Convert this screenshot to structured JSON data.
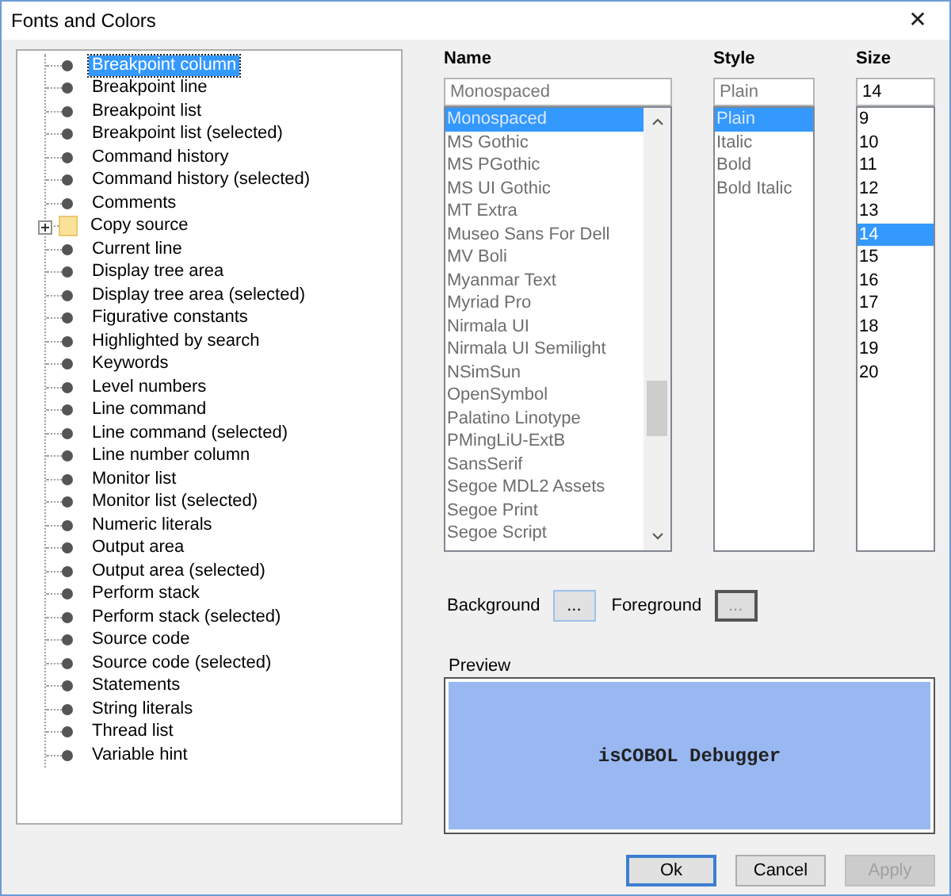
{
  "window": {
    "title": "Fonts and Colors",
    "close": "✕"
  },
  "tree": {
    "items": [
      {
        "label": "Breakpoint column",
        "kind": "leaf",
        "selected": true
      },
      {
        "label": "Breakpoint line",
        "kind": "leaf",
        "selected": false
      },
      {
        "label": "Breakpoint list",
        "kind": "leaf",
        "selected": false
      },
      {
        "label": "Breakpoint list (selected)",
        "kind": "leaf",
        "selected": false
      },
      {
        "label": "Command history",
        "kind": "leaf",
        "selected": false
      },
      {
        "label": "Command history (selected)",
        "kind": "leaf",
        "selected": false
      },
      {
        "label": "Comments",
        "kind": "leaf",
        "selected": false
      },
      {
        "label": "Copy source",
        "kind": "folder",
        "expanded": false,
        "selected": false
      },
      {
        "label": "Current line",
        "kind": "leaf",
        "selected": false
      },
      {
        "label": "Display tree area",
        "kind": "leaf",
        "selected": false
      },
      {
        "label": "Display tree area (selected)",
        "kind": "leaf",
        "selected": false
      },
      {
        "label": "Figurative constants",
        "kind": "leaf",
        "selected": false
      },
      {
        "label": "Highlighted by search",
        "kind": "leaf",
        "selected": false
      },
      {
        "label": "Keywords",
        "kind": "leaf",
        "selected": false
      },
      {
        "label": "Level numbers",
        "kind": "leaf",
        "selected": false
      },
      {
        "label": "Line command",
        "kind": "leaf",
        "selected": false
      },
      {
        "label": "Line command (selected)",
        "kind": "leaf",
        "selected": false
      },
      {
        "label": "Line number column",
        "kind": "leaf",
        "selected": false
      },
      {
        "label": "Monitor list",
        "kind": "leaf",
        "selected": false
      },
      {
        "label": "Monitor list (selected)",
        "kind": "leaf",
        "selected": false
      },
      {
        "label": "Numeric literals",
        "kind": "leaf",
        "selected": false
      },
      {
        "label": "Output area",
        "kind": "leaf",
        "selected": false
      },
      {
        "label": "Output area (selected)",
        "kind": "leaf",
        "selected": false
      },
      {
        "label": "Perform stack",
        "kind": "leaf",
        "selected": false
      },
      {
        "label": "Perform stack (selected)",
        "kind": "leaf",
        "selected": false
      },
      {
        "label": "Source code",
        "kind": "leaf",
        "selected": false
      },
      {
        "label": "Source code (selected)",
        "kind": "leaf",
        "selected": false
      },
      {
        "label": "Statements",
        "kind": "leaf",
        "selected": false
      },
      {
        "label": "String literals",
        "kind": "leaf",
        "selected": false
      },
      {
        "label": "Thread list",
        "kind": "leaf",
        "selected": false
      },
      {
        "label": "Variable hint",
        "kind": "leaf",
        "selected": false
      }
    ]
  },
  "font_columns": [
    {
      "heading": "Name",
      "value": "Monospaced",
      "disabled": true,
      "scrollbar": true,
      "options": [
        {
          "label": "Monospaced",
          "selected": true
        },
        {
          "label": "MS Gothic",
          "selected": false
        },
        {
          "label": "MS PGothic",
          "selected": false
        },
        {
          "label": "MS UI Gothic",
          "selected": false
        },
        {
          "label": "MT Extra",
          "selected": false
        },
        {
          "label": "Museo Sans For Dell",
          "selected": false
        },
        {
          "label": "MV Boli",
          "selected": false
        },
        {
          "label": "Myanmar Text",
          "selected": false
        },
        {
          "label": "Myriad Pro",
          "selected": false
        },
        {
          "label": "Nirmala UI",
          "selected": false
        },
        {
          "label": "Nirmala UI Semilight",
          "selected": false
        },
        {
          "label": "NSimSun",
          "selected": false
        },
        {
          "label": "OpenSymbol",
          "selected": false
        },
        {
          "label": "Palatino Linotype",
          "selected": false
        },
        {
          "label": "PMingLiU-ExtB",
          "selected": false
        },
        {
          "label": "SansSerif",
          "selected": false
        },
        {
          "label": "Segoe MDL2 Assets",
          "selected": false
        },
        {
          "label": "Segoe Print",
          "selected": false
        },
        {
          "label": "Segoe Script",
          "selected": false
        }
      ]
    },
    {
      "heading": "Style",
      "value": "Plain",
      "disabled": true,
      "scrollbar": false,
      "options": [
        {
          "label": "Plain",
          "selected": true
        },
        {
          "label": "Italic",
          "selected": false
        },
        {
          "label": "Bold",
          "selected": false
        },
        {
          "label": "Bold Italic",
          "selected": false
        }
      ]
    },
    {
      "heading": "Size",
      "value": "14",
      "disabled": false,
      "scrollbar": false,
      "options": [
        {
          "label": "9",
          "selected": false
        },
        {
          "label": "10",
          "selected": false
        },
        {
          "label": "11",
          "selected": false
        },
        {
          "label": "12",
          "selected": false
        },
        {
          "label": "13",
          "selected": false
        },
        {
          "label": "14",
          "selected": true
        },
        {
          "label": "15",
          "selected": false
        },
        {
          "label": "16",
          "selected": false
        },
        {
          "label": "17",
          "selected": false
        },
        {
          "label": "18",
          "selected": false
        },
        {
          "label": "19",
          "selected": false
        },
        {
          "label": "20",
          "selected": false
        }
      ]
    }
  ],
  "colors": [
    {
      "label": "Background",
      "button": "...",
      "disabled": false
    },
    {
      "label": "Foreground",
      "button": "...",
      "disabled": true
    }
  ],
  "preview": {
    "label": "Preview",
    "text": "isCOBOL Debugger",
    "color": "#99b8f2"
  },
  "buttons": [
    {
      "label": "Ok",
      "disabled": false,
      "default": true
    },
    {
      "label": "Cancel",
      "disabled": false,
      "default": false
    },
    {
      "label": "Apply",
      "disabled": true,
      "default": false
    }
  ]
}
